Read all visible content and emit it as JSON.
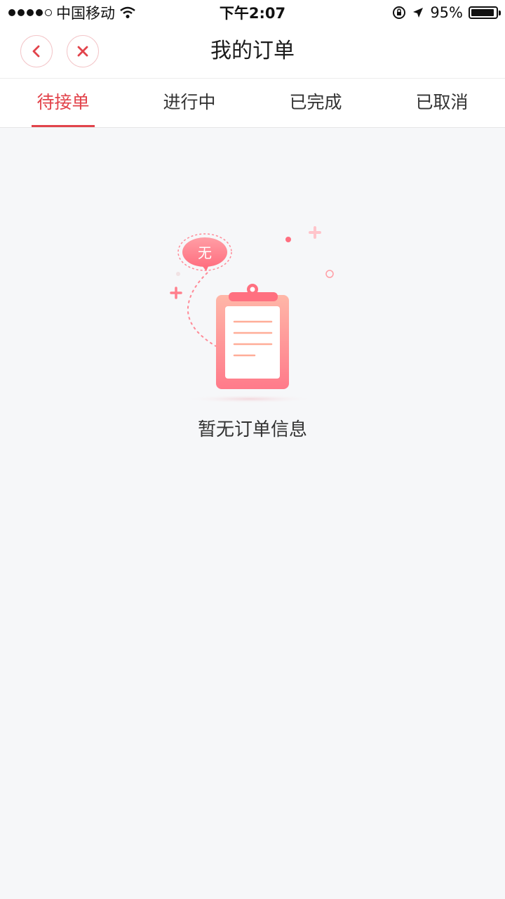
{
  "status_bar": {
    "carrier": "中国移动",
    "time": "下午2:07",
    "battery_percent": "95%",
    "battery_level": 0.95,
    "signal_bars_filled": 4,
    "signal_bars_total": 5
  },
  "nav": {
    "title": "我的订单",
    "back_icon": "chevron-left-icon",
    "close_icon": "close-icon"
  },
  "tabs": [
    {
      "label": "待接单",
      "active": true
    },
    {
      "label": "进行中",
      "active": false
    },
    {
      "label": "已完成",
      "active": false
    },
    {
      "label": "已取消",
      "active": false
    }
  ],
  "empty_state": {
    "badge_text": "无",
    "message": "暂无订单信息",
    "icon": "clipboard-icon"
  },
  "colors": {
    "accent": "#e2434b",
    "background": "#f6f7f9",
    "pink": "#ff7f8c"
  }
}
